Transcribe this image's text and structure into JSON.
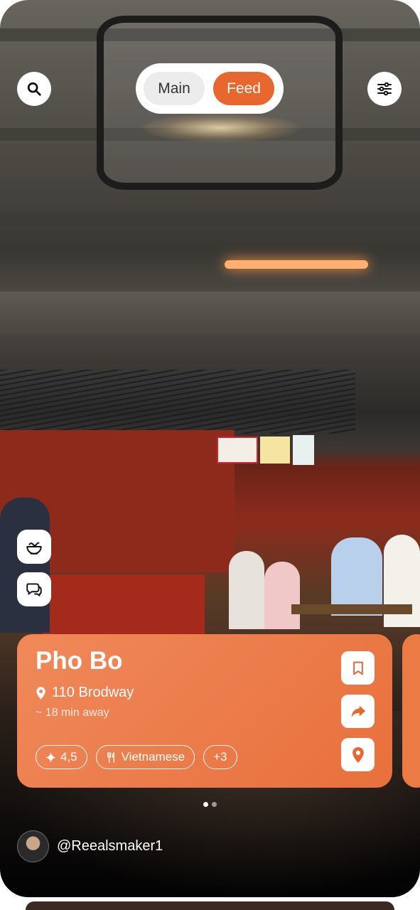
{
  "header": {
    "toggle": {
      "main_label": "Main",
      "feed_label": "Feed",
      "active": "Feed"
    },
    "search_icon": "search-icon",
    "filter_icon": "sliders-icon"
  },
  "side_actions": [
    {
      "icon": "food-bowl-icon"
    },
    {
      "icon": "chat-bubbles-icon"
    }
  ],
  "card": {
    "title": "Pho Bo",
    "address": "110 Brodway",
    "distance": "~ 18 min away",
    "tags": [
      {
        "icon": "sparkle-icon",
        "label": "4,5"
      },
      {
        "icon": "fork-knife-icon",
        "label": "Vietnamese"
      },
      {
        "icon": "",
        "label": "+3"
      }
    ],
    "actions": [
      "bookmark-icon",
      "share-arrow-icon",
      "map-pin-icon"
    ]
  },
  "pagination": {
    "count": 2,
    "current": 1
  },
  "author": {
    "handle": "@Reealsmaker1"
  },
  "colors": {
    "accent": "#e8672f",
    "card": "#ee7e4b",
    "white": "#ffffff"
  }
}
